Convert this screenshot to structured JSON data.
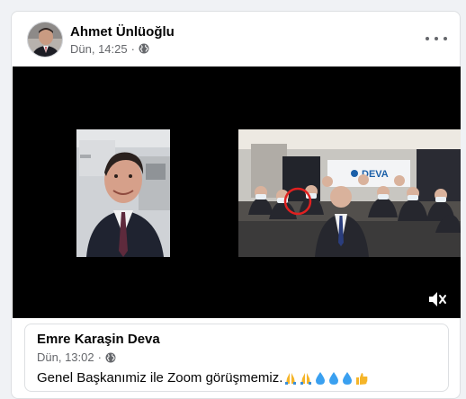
{
  "post": {
    "author": "Ahmet Ünlüoğlu",
    "time": "Dün, 14:25",
    "separator": "·",
    "privacy_icon": "globe-icon",
    "more_icon": "more-options-icon"
  },
  "video": {
    "left_panel_logo": "DEVA",
    "mute_icon": "speaker-muted-icon"
  },
  "shared_post": {
    "author": "Emre Karaşin Deva",
    "time": "Dün, 13:02",
    "separator": "·",
    "privacy_icon": "globe-icon",
    "text": "Genel Başkanımiz ile Zoom görüşmemiz.",
    "emojis": [
      "folded-hands",
      "folded-hands",
      "droplet",
      "droplet",
      "droplet",
      "thumbs-up"
    ]
  },
  "colors": {
    "page_bg": "#f0f2f5",
    "card_bg": "#ffffff",
    "secondary_text": "#65676b",
    "highlight_circle": "#e02020"
  }
}
